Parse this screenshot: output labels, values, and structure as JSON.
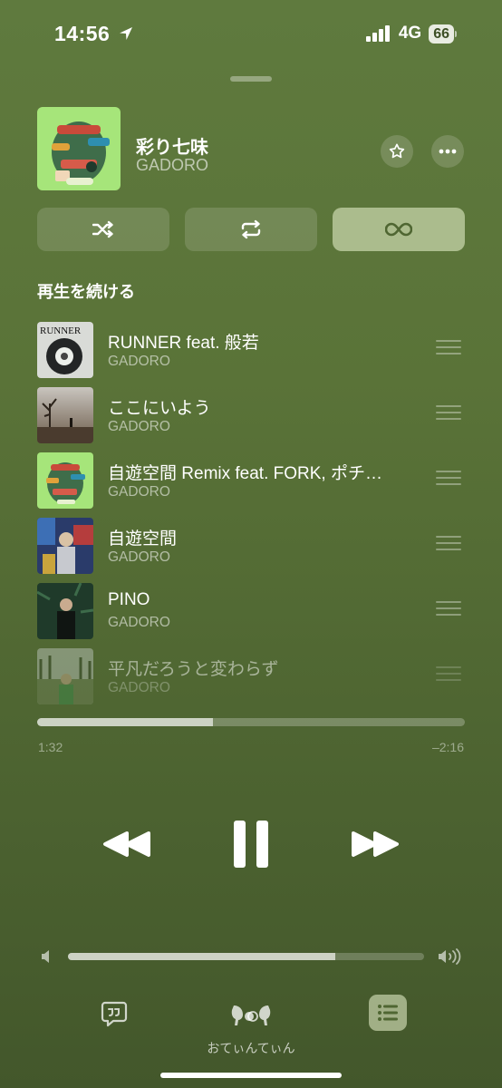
{
  "status_bar": {
    "time": "14:56",
    "network": "4G",
    "battery": "66"
  },
  "now_playing": {
    "title": "彩り七味",
    "artist": "GADORO"
  },
  "modes": {
    "shuffle_icon": "shuffle-icon",
    "repeat_icon": "repeat-icon",
    "autoplay_icon": "infinity-icon",
    "autoplay_active": true
  },
  "queue": {
    "section_title": "再生を続ける",
    "items": [
      {
        "title": "RUNNER feat. 般若",
        "artist": "GADORO"
      },
      {
        "title": "ここにいよう",
        "artist": "GADORO"
      },
      {
        "title": "自遊空間 Remix feat. FORK, ポチ…",
        "artist": "GADORO"
      },
      {
        "title": "自遊空間",
        "artist": "GADORO"
      },
      {
        "title": "PINO",
        "artist": "GADORO"
      },
      {
        "title": "平凡だろうと変わらず",
        "artist": "GADORO"
      }
    ]
  },
  "playback": {
    "elapsed": "1:32",
    "remaining": "–2:16",
    "progress_fraction": 0.41
  },
  "volume": {
    "level_fraction": 0.75
  },
  "bottom_bar": {
    "airplay_device_label": "おてぃんてぃん"
  },
  "colors": {
    "background": "#5a7338",
    "accent_light": "#ecf5d2"
  }
}
